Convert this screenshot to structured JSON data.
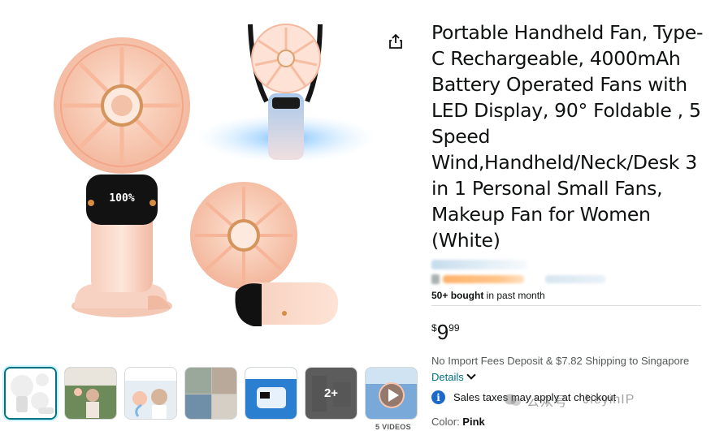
{
  "product": {
    "title": "Portable Handheld Fan, Type-C Rechargeable, 4000mAh Battery Operated Fans with LED Display, 90° Foldable , 5 Speed Wind,Handheld/Neck/Desk 3 in 1 Personal Small Fans, Makeup Fan for Women (White)",
    "bought_strong": "50+ bought",
    "bought_rest": " in past month",
    "price_symbol": "$",
    "price_whole": "9",
    "price_fraction": "99",
    "shipping_text": "No Import Fees Deposit & $7.82 Shipping to Singapore ",
    "details_label": "Details",
    "tax_text": "Sales taxes may apply at checkout",
    "color_label": "Color: ",
    "color_value": "Pink",
    "display_reading": "100%"
  },
  "gallery": {
    "more_label": "2+",
    "videos_label": "5 VIDEOS"
  },
  "watermark": {
    "left_text": "公众号",
    "right_text": "JieyinIP"
  },
  "colors": {
    "fan_pink": "#f7c4ad",
    "fan_deep": "#f0a98b",
    "link": "#007185",
    "info_blue": "#1b6ac9",
    "selected_thumb": "#007185"
  }
}
